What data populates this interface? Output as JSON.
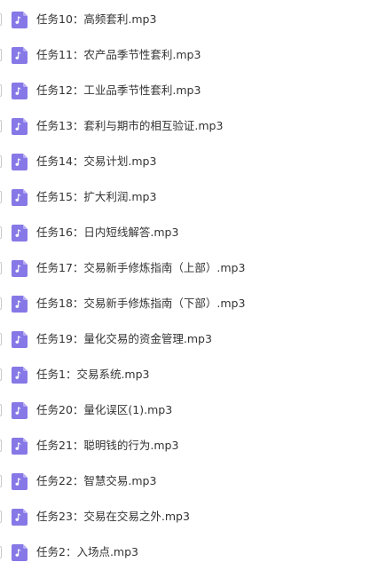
{
  "colors": {
    "icon_bg": "#8678e6",
    "icon_fold": "#b6acf2",
    "text": "#333333"
  },
  "files": [
    {
      "name": "任务10：高频套利.mp3",
      "icon": "audio-file-icon"
    },
    {
      "name": "任务11：农产品季节性套利.mp3",
      "icon": "audio-file-icon"
    },
    {
      "name": "任务12：工业品季节性套利.mp3",
      "icon": "audio-file-icon"
    },
    {
      "name": "任务13：套利与期市的相互验证.mp3",
      "icon": "audio-file-icon"
    },
    {
      "name": "任务14：交易计划.mp3",
      "icon": "audio-file-icon"
    },
    {
      "name": "任务15：扩大利润.mp3",
      "icon": "audio-file-icon"
    },
    {
      "name": "任务16：日内短线解答.mp3",
      "icon": "audio-file-icon"
    },
    {
      "name": "任务17：交易新手修炼指南（上部）.mp3",
      "icon": "audio-file-icon"
    },
    {
      "name": "任务18：交易新手修炼指南（下部）.mp3",
      "icon": "audio-file-icon"
    },
    {
      "name": "任务19：量化交易的资金管理.mp3",
      "icon": "audio-file-icon"
    },
    {
      "name": "任务1：交易系统.mp3",
      "icon": "audio-file-icon"
    },
    {
      "name": "任务20：量化误区(1).mp3",
      "icon": "audio-file-icon"
    },
    {
      "name": "任务21：聪明钱的行为.mp3",
      "icon": "audio-file-icon"
    },
    {
      "name": "任务22：智慧交易.mp3",
      "icon": "audio-file-icon"
    },
    {
      "name": "任务23：交易在交易之外.mp3",
      "icon": "audio-file-icon"
    },
    {
      "name": "任务2：入场点.mp3",
      "icon": "audio-file-icon"
    }
  ]
}
